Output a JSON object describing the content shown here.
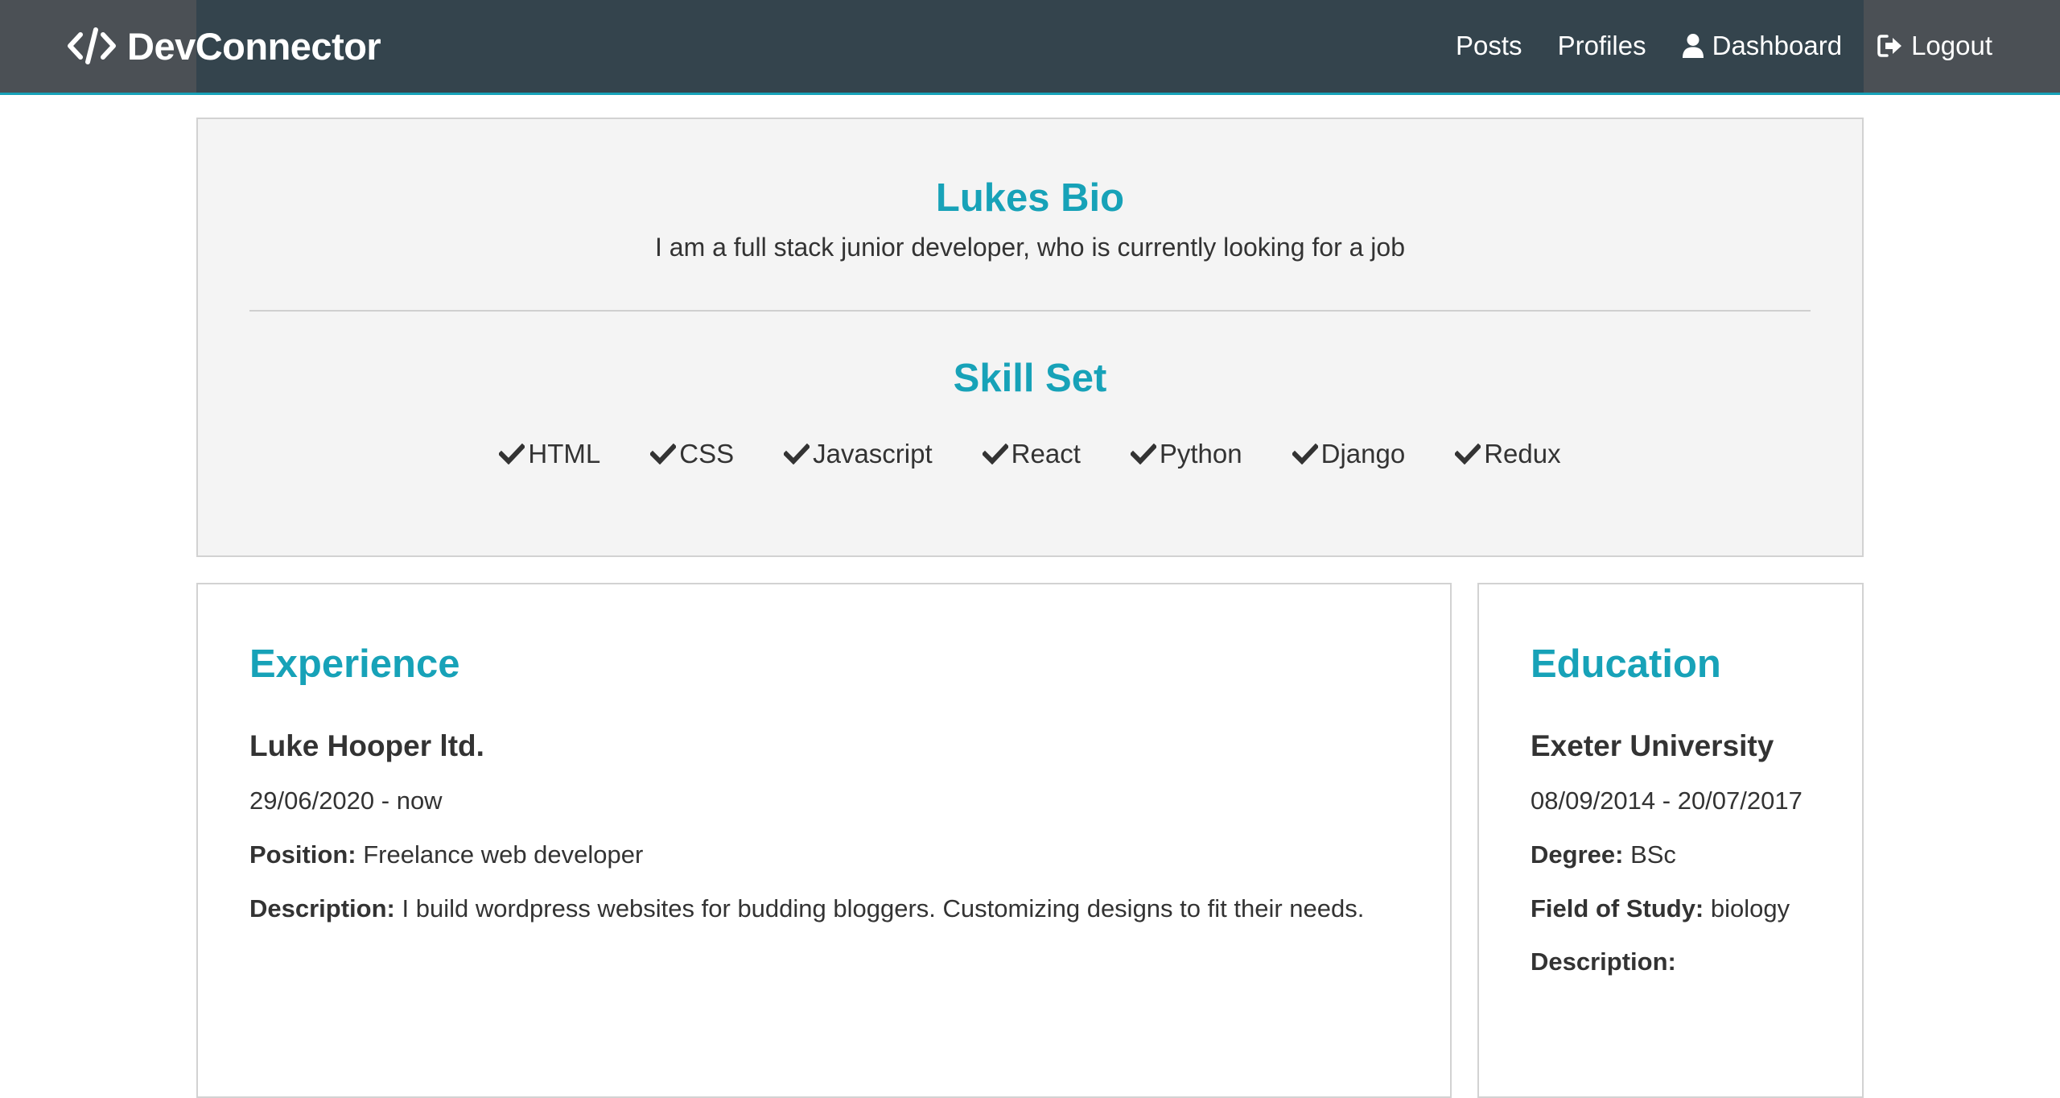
{
  "navbar": {
    "brand": "DevConnector",
    "links": [
      {
        "label": "Posts"
      },
      {
        "label": "Profiles"
      },
      {
        "label": "Dashboard",
        "icon": "user-icon"
      },
      {
        "label": "Logout",
        "icon": "sign-out-icon"
      }
    ],
    "accent_color": "#17a2b8"
  },
  "bio": {
    "title": "Lukes Bio",
    "text": "I am a full stack junior developer, who is currently looking for a job",
    "skill_title": "Skill Set",
    "skills": [
      "HTML",
      "CSS",
      "Javascript",
      "React",
      "Python",
      "Django",
      "Redux"
    ]
  },
  "experience": {
    "heading": "Experience",
    "items": [
      {
        "company": "Luke Hooper ltd.",
        "dates": "29/06/2020 - now",
        "position_label": "Position:",
        "position": "Freelance web developer",
        "description_label": "Description:",
        "description": "I build wordpress websites for budding bloggers. Customizing designs to fit their needs."
      }
    ]
  },
  "education": {
    "heading": "Education",
    "items": [
      {
        "school": "Exeter University",
        "dates": "08/09/2014 - 20/07/2017",
        "degree_label": "Degree:",
        "degree": "BSc",
        "field_label": "Field of Study:",
        "field": "biology",
        "description_label": "Description:",
        "description": ""
      }
    ]
  }
}
